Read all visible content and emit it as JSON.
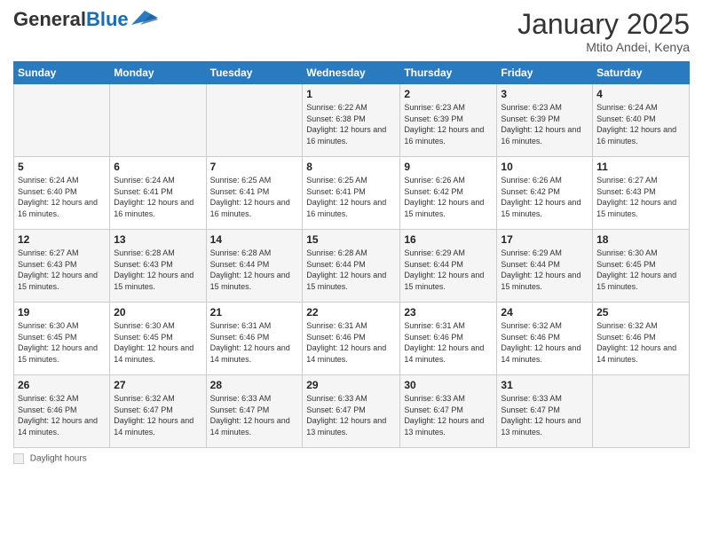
{
  "header": {
    "logo_general": "General",
    "logo_blue": "Blue",
    "month_title": "January 2025",
    "location": "Mtito Andei, Kenya"
  },
  "days_of_week": [
    "Sunday",
    "Monday",
    "Tuesday",
    "Wednesday",
    "Thursday",
    "Friday",
    "Saturday"
  ],
  "weeks": [
    [
      {
        "day": "",
        "info": ""
      },
      {
        "day": "",
        "info": ""
      },
      {
        "day": "",
        "info": ""
      },
      {
        "day": "1",
        "info": "Sunrise: 6:22 AM\nSunset: 6:38 PM\nDaylight: 12 hours and 16 minutes."
      },
      {
        "day": "2",
        "info": "Sunrise: 6:23 AM\nSunset: 6:39 PM\nDaylight: 12 hours and 16 minutes."
      },
      {
        "day": "3",
        "info": "Sunrise: 6:23 AM\nSunset: 6:39 PM\nDaylight: 12 hours and 16 minutes."
      },
      {
        "day": "4",
        "info": "Sunrise: 6:24 AM\nSunset: 6:40 PM\nDaylight: 12 hours and 16 minutes."
      }
    ],
    [
      {
        "day": "5",
        "info": "Sunrise: 6:24 AM\nSunset: 6:40 PM\nDaylight: 12 hours and 16 minutes."
      },
      {
        "day": "6",
        "info": "Sunrise: 6:24 AM\nSunset: 6:41 PM\nDaylight: 12 hours and 16 minutes."
      },
      {
        "day": "7",
        "info": "Sunrise: 6:25 AM\nSunset: 6:41 PM\nDaylight: 12 hours and 16 minutes."
      },
      {
        "day": "8",
        "info": "Sunrise: 6:25 AM\nSunset: 6:41 PM\nDaylight: 12 hours and 16 minutes."
      },
      {
        "day": "9",
        "info": "Sunrise: 6:26 AM\nSunset: 6:42 PM\nDaylight: 12 hours and 15 minutes."
      },
      {
        "day": "10",
        "info": "Sunrise: 6:26 AM\nSunset: 6:42 PM\nDaylight: 12 hours and 15 minutes."
      },
      {
        "day": "11",
        "info": "Sunrise: 6:27 AM\nSunset: 6:43 PM\nDaylight: 12 hours and 15 minutes."
      }
    ],
    [
      {
        "day": "12",
        "info": "Sunrise: 6:27 AM\nSunset: 6:43 PM\nDaylight: 12 hours and 15 minutes."
      },
      {
        "day": "13",
        "info": "Sunrise: 6:28 AM\nSunset: 6:43 PM\nDaylight: 12 hours and 15 minutes."
      },
      {
        "day": "14",
        "info": "Sunrise: 6:28 AM\nSunset: 6:44 PM\nDaylight: 12 hours and 15 minutes."
      },
      {
        "day": "15",
        "info": "Sunrise: 6:28 AM\nSunset: 6:44 PM\nDaylight: 12 hours and 15 minutes."
      },
      {
        "day": "16",
        "info": "Sunrise: 6:29 AM\nSunset: 6:44 PM\nDaylight: 12 hours and 15 minutes."
      },
      {
        "day": "17",
        "info": "Sunrise: 6:29 AM\nSunset: 6:44 PM\nDaylight: 12 hours and 15 minutes."
      },
      {
        "day": "18",
        "info": "Sunrise: 6:30 AM\nSunset: 6:45 PM\nDaylight: 12 hours and 15 minutes."
      }
    ],
    [
      {
        "day": "19",
        "info": "Sunrise: 6:30 AM\nSunset: 6:45 PM\nDaylight: 12 hours and 15 minutes."
      },
      {
        "day": "20",
        "info": "Sunrise: 6:30 AM\nSunset: 6:45 PM\nDaylight: 12 hours and 14 minutes."
      },
      {
        "day": "21",
        "info": "Sunrise: 6:31 AM\nSunset: 6:46 PM\nDaylight: 12 hours and 14 minutes."
      },
      {
        "day": "22",
        "info": "Sunrise: 6:31 AM\nSunset: 6:46 PM\nDaylight: 12 hours and 14 minutes."
      },
      {
        "day": "23",
        "info": "Sunrise: 6:31 AM\nSunset: 6:46 PM\nDaylight: 12 hours and 14 minutes."
      },
      {
        "day": "24",
        "info": "Sunrise: 6:32 AM\nSunset: 6:46 PM\nDaylight: 12 hours and 14 minutes."
      },
      {
        "day": "25",
        "info": "Sunrise: 6:32 AM\nSunset: 6:46 PM\nDaylight: 12 hours and 14 minutes."
      }
    ],
    [
      {
        "day": "26",
        "info": "Sunrise: 6:32 AM\nSunset: 6:46 PM\nDaylight: 12 hours and 14 minutes."
      },
      {
        "day": "27",
        "info": "Sunrise: 6:32 AM\nSunset: 6:47 PM\nDaylight: 12 hours and 14 minutes."
      },
      {
        "day": "28",
        "info": "Sunrise: 6:33 AM\nSunset: 6:47 PM\nDaylight: 12 hours and 14 minutes."
      },
      {
        "day": "29",
        "info": "Sunrise: 6:33 AM\nSunset: 6:47 PM\nDaylight: 12 hours and 13 minutes."
      },
      {
        "day": "30",
        "info": "Sunrise: 6:33 AM\nSunset: 6:47 PM\nDaylight: 12 hours and 13 minutes."
      },
      {
        "day": "31",
        "info": "Sunrise: 6:33 AM\nSunset: 6:47 PM\nDaylight: 12 hours and 13 minutes."
      },
      {
        "day": "",
        "info": ""
      }
    ]
  ],
  "footer": {
    "daylight_label": "Daylight hours"
  }
}
